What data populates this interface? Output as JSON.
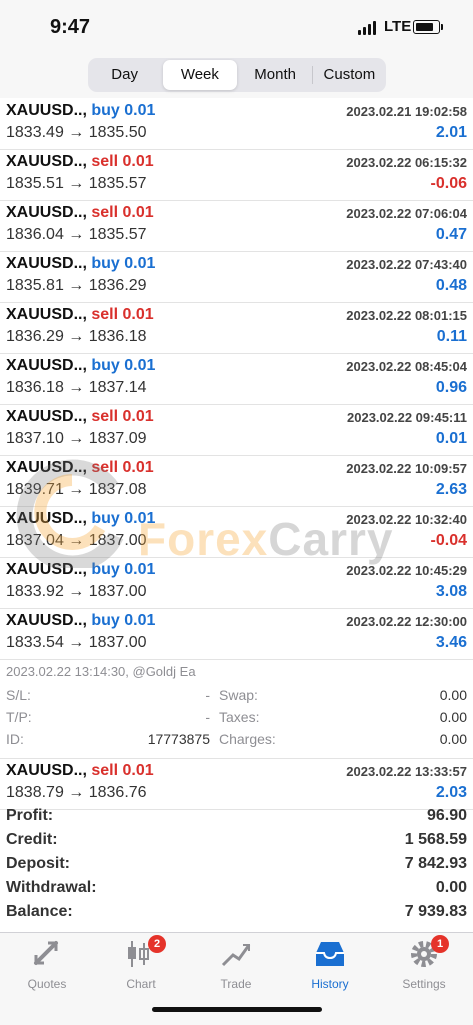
{
  "status": {
    "time": "9:47",
    "network": "LTE"
  },
  "segments": [
    {
      "label": "Day",
      "active": false
    },
    {
      "label": "Week",
      "active": true
    },
    {
      "label": "Month",
      "active": false
    },
    {
      "label": "Custom",
      "active": false
    }
  ],
  "trades": [
    {
      "symbol": "XAUUSD..,",
      "side": "buy",
      "volume": "0.01",
      "date": "2023.02.21 19:02:58",
      "prices": "1833.49 → 1835.50",
      "profit": "2.01"
    },
    {
      "symbol": "XAUUSD..,",
      "side": "sell",
      "volume": "0.01",
      "date": "2023.02.22 06:15:32",
      "prices": "1835.51 → 1835.57",
      "profit": "-0.06"
    },
    {
      "symbol": "XAUUSD..,",
      "side": "sell",
      "volume": "0.01",
      "date": "2023.02.22 07:06:04",
      "prices": "1836.04 → 1835.57",
      "profit": "0.47"
    },
    {
      "symbol": "XAUUSD..,",
      "side": "buy",
      "volume": "0.01",
      "date": "2023.02.22 07:43:40",
      "prices": "1835.81 → 1836.29",
      "profit": "0.48"
    },
    {
      "symbol": "XAUUSD..,",
      "side": "sell",
      "volume": "0.01",
      "date": "2023.02.22 08:01:15",
      "prices": "1836.29 → 1836.18",
      "profit": "0.11"
    },
    {
      "symbol": "XAUUSD..,",
      "side": "buy",
      "volume": "0.01",
      "date": "2023.02.22 08:45:04",
      "prices": "1836.18 → 1837.14",
      "profit": "0.96"
    },
    {
      "symbol": "XAUUSD..,",
      "side": "sell",
      "volume": "0.01",
      "date": "2023.02.22 09:45:11",
      "prices": "1837.10 → 1837.09",
      "profit": "0.01"
    },
    {
      "symbol": "XAUUSD..,",
      "side": "sell",
      "volume": "0.01",
      "date": "2023.02.22 10:09:57",
      "prices": "1839.71 → 1837.08",
      "profit": "2.63"
    },
    {
      "symbol": "XAUUSD..,",
      "side": "buy",
      "volume": "0.01",
      "date": "2023.02.22 10:32:40",
      "prices": "1837.04 → 1837.00",
      "profit": "-0.04"
    },
    {
      "symbol": "XAUUSD..,",
      "side": "buy",
      "volume": "0.01",
      "date": "2023.02.22 10:45:29",
      "prices": "1833.92 → 1837.00",
      "profit": "3.08"
    },
    {
      "symbol": "XAUUSD..,",
      "side": "buy",
      "volume": "0.01",
      "date": "2023.02.22 12:30:00",
      "prices": "1833.54 → 1837.00",
      "profit": "3.46"
    }
  ],
  "expanded": {
    "meta": "2023.02.22 13:14:30, @Goldj Ea",
    "sl_label": "S/L:",
    "sl_value": "-",
    "tp_label": "T/P:",
    "tp_value": "-",
    "id_label": "ID:",
    "id_value": "17773875",
    "swap_label": "Swap:",
    "swap_value": "0.00",
    "taxes_label": "Taxes:",
    "taxes_value": "0.00",
    "charges_label": "Charges:",
    "charges_value": "0.00"
  },
  "last_trade": {
    "symbol": "XAUUSD..,",
    "side": "sell",
    "volume": "0.01",
    "date": "2023.02.22 13:33:57",
    "prices": "1838.79 → 1836.76",
    "profit": "2.03"
  },
  "summary": [
    {
      "label": "Profit:",
      "value": "96.90"
    },
    {
      "label": "Credit:",
      "value": "1 568.59"
    },
    {
      "label": "Deposit:",
      "value": "7 842.93"
    },
    {
      "label": "Withdrawal:",
      "value": "0.00"
    },
    {
      "label": "Balance:",
      "value": "7 939.83"
    }
  ],
  "watermark": {
    "part1": "Forex",
    "part2": "Carry"
  },
  "tabs": [
    {
      "label": "Quotes",
      "icon": "quotes-icon",
      "badge": ""
    },
    {
      "label": "Chart",
      "icon": "chart-icon",
      "badge": "2"
    },
    {
      "label": "Trade",
      "icon": "trade-icon",
      "badge": ""
    },
    {
      "label": "History",
      "icon": "history-icon",
      "badge": "",
      "active": true
    },
    {
      "label": "Settings",
      "icon": "settings-icon",
      "badge": "1"
    }
  ],
  "colors": {
    "buy": "#1a6fd1",
    "sell": "#d9302c",
    "accent": "#1a6fd1"
  }
}
